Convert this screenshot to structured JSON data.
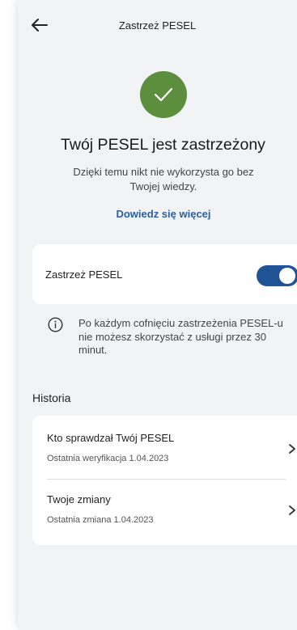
{
  "header": {
    "back_icon": "arrow-left-icon",
    "title": "Zastrzeż PESEL"
  },
  "status": {
    "icon": "check-icon",
    "color": "#5c8e3e",
    "title": "Twój PESEL jest zastrzeżony",
    "description": "Dzięki temu nikt nie wykorzysta go bez Twojej wiedzy.",
    "link": "Dowiedz się więcej"
  },
  "toggle": {
    "label": "Zastrzeż PESEL",
    "on": true,
    "color": "#1f5396"
  },
  "info": {
    "icon": "info-icon",
    "text": "Po każdym cofnięciu zastrzeżenia PESEL-u nie możesz skorzystać z usługi przez 30 minut."
  },
  "history": {
    "title": "Historia",
    "items": [
      {
        "title": "Kto sprawdzał Twój PESEL",
        "subtitle": "Ostatnia weryfikacja 1.04.2023",
        "icon": "chevron-right-icon"
      },
      {
        "title": "Twoje zmiany",
        "subtitle": "Ostatnia zmiana 1.04.2023",
        "icon": "chevron-right-icon"
      }
    ]
  }
}
